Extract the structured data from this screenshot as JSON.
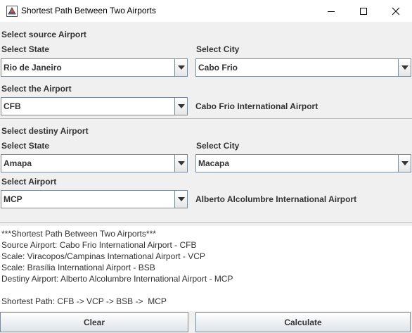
{
  "window": {
    "title": "Shortest Path Between Two Airports"
  },
  "source": {
    "heading": "Select source Airport",
    "state_label": "Select State",
    "state_value": "Rio de Janeiro",
    "city_label": "Select City",
    "city_value": "Cabo Frio",
    "airport_label": "Select the Airport",
    "airport_value": "CFB",
    "airport_name": "Cabo Frio International Airport"
  },
  "destiny": {
    "heading": "Select destiny Airport",
    "state_label": "Select State",
    "state_value": "Amapa",
    "city_label": "Select City",
    "city_value": "Macapa",
    "airport_label": "Select Airport",
    "airport_value": "MCP",
    "airport_name": "Alberto Alcolumbre International Airport"
  },
  "result": {
    "lines": [
      "***Shortest Path Between Two Airports***",
      "Source Airport: Cabo Frio International Airport - CFB",
      "Scale: Viracopos/Campinas International Airport - VCP",
      "Scale: Brasília International Airport - BSB",
      "Destiny Airport: Alberto Alcolumbre International Airport - MCP",
      "",
      "Shortest Path: CFB -> VCP -> BSB ->  MCP"
    ]
  },
  "buttons": {
    "clear": "Clear",
    "calculate": "Calculate"
  }
}
